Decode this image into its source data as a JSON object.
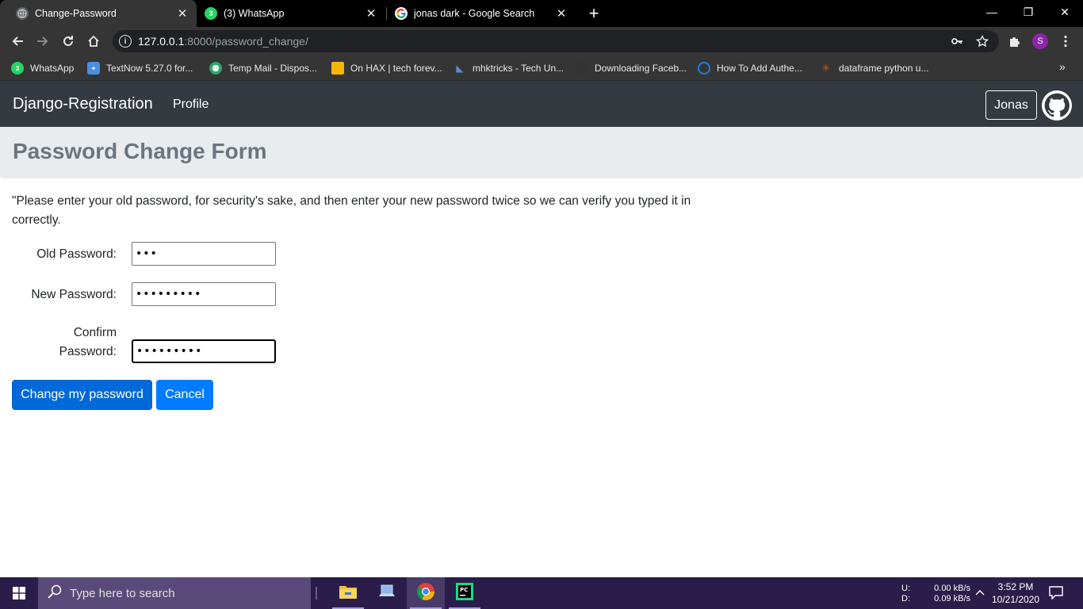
{
  "browser": {
    "tabs": [
      {
        "title": "Change-Password",
        "active": true
      },
      {
        "title": "(3) WhatsApp",
        "badge": "3",
        "active": false
      },
      {
        "title": "jonas dark - Google Search",
        "active": false
      }
    ],
    "window_controls": {
      "minimize": "—",
      "restore": "❐",
      "close": "✕"
    },
    "address": {
      "host": "127.0.0.1",
      "path": ":8000/password_change/"
    },
    "profile_initial": "S",
    "bookmarks": [
      {
        "label": "WhatsApp",
        "icon": "whatsapp-icon",
        "color": "#25d366",
        "glyph": "3"
      },
      {
        "label": "TextNow 5.27.0 for...",
        "icon": "textnow-icon",
        "color": "#4a90e2",
        "glyph": "✦"
      },
      {
        "label": "Temp Mail - Dispos...",
        "icon": "tempmail-icon",
        "color": "#2fa56e",
        "glyph": "Ⓣ"
      },
      {
        "label": "On HAX | tech forev...",
        "icon": "onhax-icon",
        "color": "#f5b800",
        "glyph": "▢"
      },
      {
        "label": "mhktricks - Tech Un...",
        "icon": "mhktricks-icon",
        "color": "#5b8bd6",
        "glyph": "◣"
      },
      {
        "label": "Downloading Faceb...",
        "icon": "github-icon",
        "color": "#333333",
        "glyph": "●"
      },
      {
        "label": "How To Add Authe...",
        "icon": "auth0-icon",
        "color": "#1f7ae0",
        "glyph": "◔"
      },
      {
        "label": "dataframe python u...",
        "icon": "pandas-icon",
        "color": "#d45500",
        "glyph": "✳"
      }
    ],
    "bookmarks_more": "»"
  },
  "site": {
    "brand": "Django-Registration",
    "nav": {
      "profile": "Profile"
    },
    "user": "Jonas"
  },
  "page": {
    "heading": "Password Change Form",
    "intro": "\"Please enter your old password, for security's sake, and then enter your new password twice so we can verify you typed it in correctly.",
    "form": {
      "old_label": "Old Password:",
      "old_value": "•••",
      "new_label": "New Password:",
      "new_value": "•••••••••",
      "confirm_label_1": "Confirm",
      "confirm_label_2": "Password:",
      "confirm_value": "•••••••••"
    },
    "buttons": {
      "submit": "Change my password",
      "cancel": "Cancel"
    }
  },
  "taskbar": {
    "search_placeholder": "Type here to search",
    "net": {
      "up_label": "U:",
      "down_label": "D:",
      "up": "0.00 kB/s",
      "down": "0.09 kB/s"
    },
    "time": "3:52 PM",
    "date": "10/21/2020"
  },
  "colors": {
    "navbar": "#343a40",
    "jumbotron": "#e9ecef",
    "primary": "#007bff",
    "taskbar": "#2b1d4a"
  }
}
